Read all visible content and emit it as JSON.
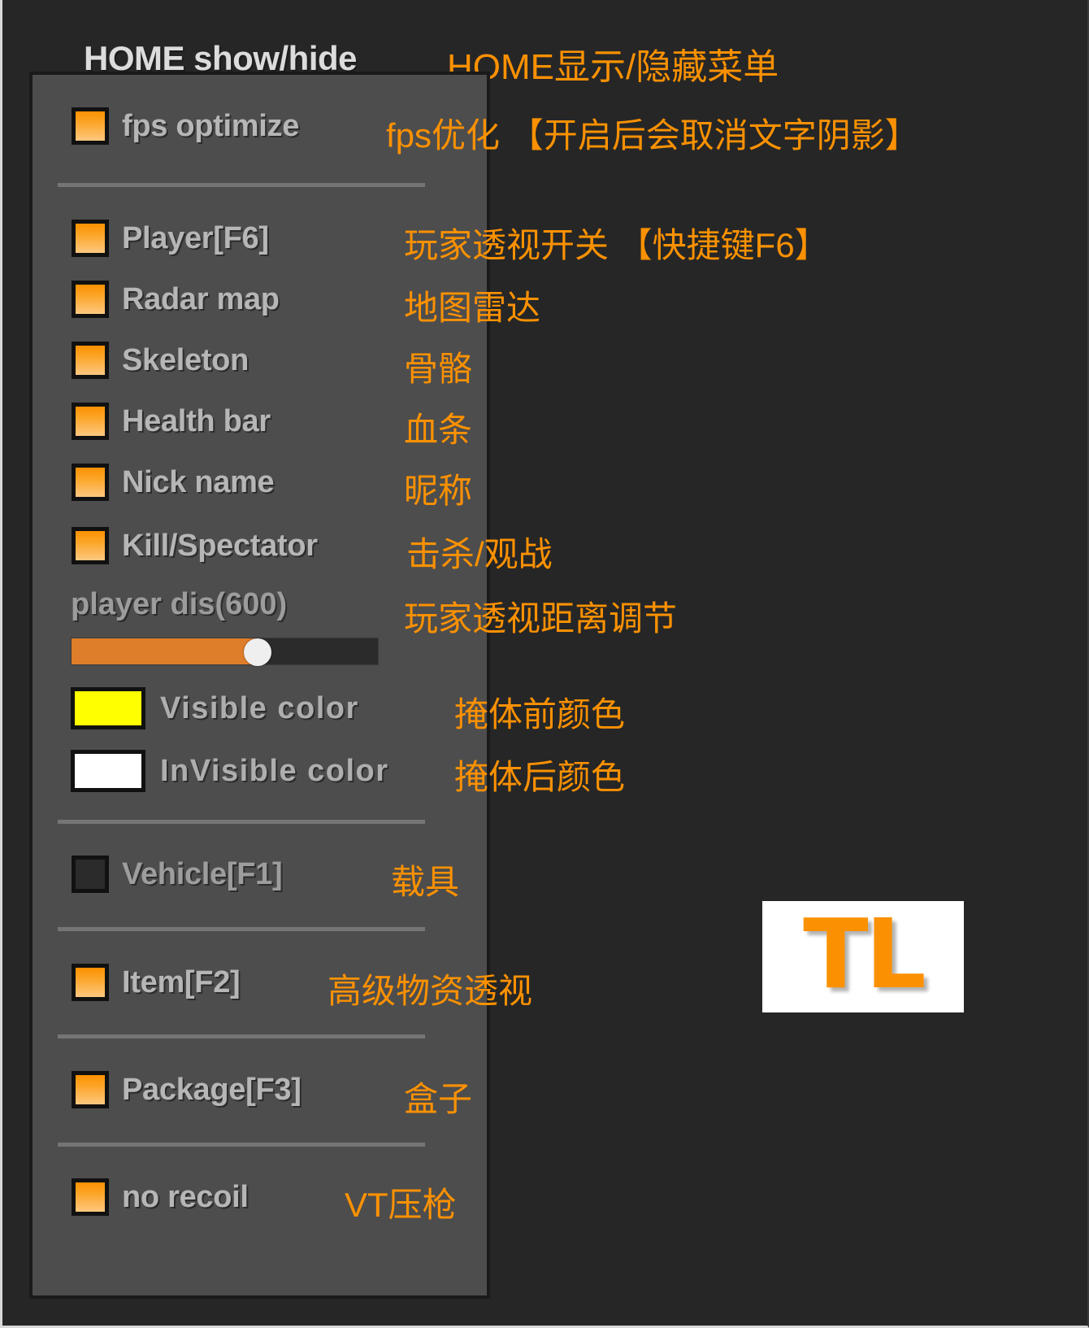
{
  "header": {
    "shortcut_label": "HOME show/hide",
    "shortcut_label_cn": "HOME显示/隐藏菜单"
  },
  "colors": {
    "accent_orange": "#FB9102",
    "panel_bg": "#4d4d4d",
    "page_bg": "#262626",
    "label_gray": "#b6b6b6",
    "visible_color": "#FFFF00",
    "invisible_color": "#FFFFFF"
  },
  "menu": {
    "sections": [
      {
        "id": "fps",
        "rows": [
          {
            "type": "checkbox",
            "label": "fps optimize",
            "cn": "fps优化 【开启后会取消文字阴影】",
            "checked": true
          }
        ]
      },
      {
        "id": "player",
        "rows": [
          {
            "type": "checkbox",
            "label": "Player[F6]",
            "cn": "玩家透视开关 【快捷键F6】",
            "checked": true
          },
          {
            "type": "checkbox",
            "label": "Radar map",
            "cn": "地图雷达",
            "checked": true
          },
          {
            "type": "checkbox",
            "label": "Skeleton",
            "cn": "骨骼",
            "checked": true
          },
          {
            "type": "checkbox",
            "label": "Health bar",
            "cn": "血条",
            "checked": true
          },
          {
            "type": "checkbox",
            "label": "Nick name",
            "cn": "昵称",
            "checked": true
          },
          {
            "type": "checkbox",
            "label": "Kill/Spectator",
            "cn": "击杀/观战",
            "checked": true
          },
          {
            "type": "slider",
            "label": "player dis(600)",
            "cn": "玩家透视距离调节",
            "value": 600,
            "fill_percent": 60
          },
          {
            "type": "color",
            "label": "Visible color",
            "cn": "掩体前颜色",
            "color": "#FFFF00"
          },
          {
            "type": "color",
            "label": "InVisible color",
            "cn": "掩体后颜色",
            "color": "#FFFFFF"
          }
        ]
      },
      {
        "id": "vehicle",
        "rows": [
          {
            "type": "checkbox",
            "label": "Vehicle[F1]",
            "cn": "载具",
            "checked": false
          }
        ]
      },
      {
        "id": "item",
        "rows": [
          {
            "type": "checkbox",
            "label": "Item[F2]",
            "cn": "高级物资透视",
            "checked": true
          }
        ]
      },
      {
        "id": "package",
        "rows": [
          {
            "type": "checkbox",
            "label": "Package[F3]",
            "cn": "盒子",
            "checked": true
          }
        ]
      },
      {
        "id": "recoil",
        "rows": [
          {
            "type": "checkbox",
            "label": "no recoil",
            "cn": "VT压枪",
            "checked": true
          }
        ]
      }
    ]
  },
  "watermark": {
    "text": "TL"
  }
}
